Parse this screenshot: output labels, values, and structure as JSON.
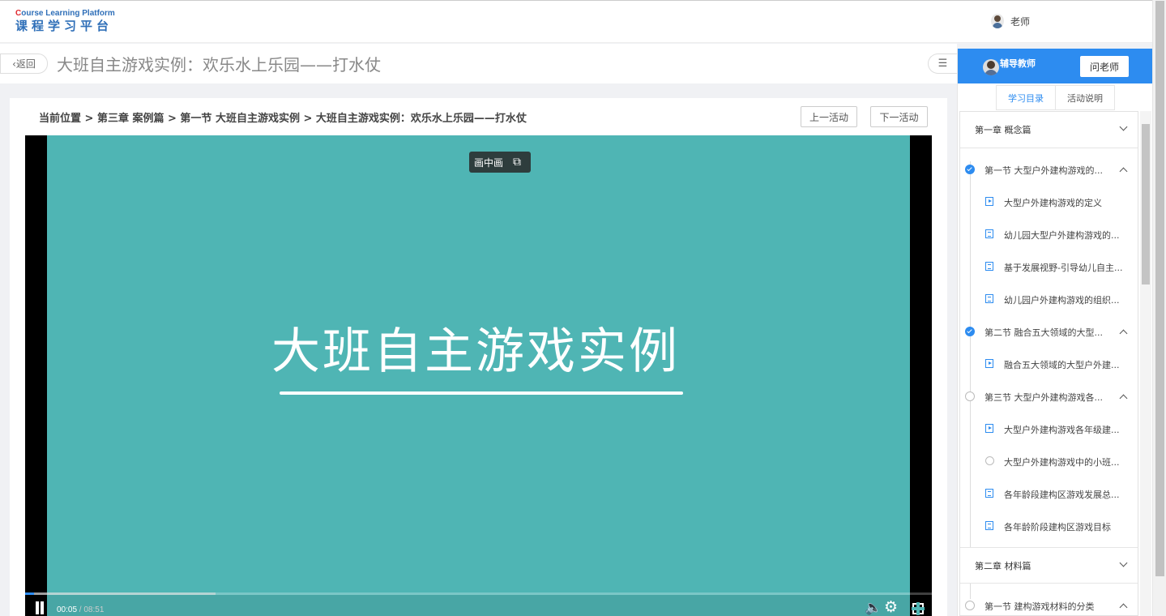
{
  "header": {
    "logo_en_first": "C",
    "logo_en_rest": "ourse Learning Platform",
    "logo_cn": "课程学习平台",
    "user_name": "老师"
  },
  "titlebar": {
    "back_label": "返回",
    "title": "大班自主游戏实例：欢乐水上乐园——打水仗"
  },
  "content": {
    "breadcrumb": "当前位置 > 第三章 案例篇 > 第一节 大班自主游戏实例 > 大班自主游戏实例：欢乐水上乐园——打水仗",
    "prev_label": "上一活动",
    "next_label": "下一活动"
  },
  "player": {
    "pip_label": "画中画",
    "video_title": "大班自主游戏实例",
    "current_time": "00:05",
    "separator": " / ",
    "duration": "08:51",
    "progress_fraction": 0.0098,
    "buffered_fraction": 0.21,
    "stage_color": "#4fb5b4"
  },
  "sidebar": {
    "tutor_label": "辅导教师",
    "ask_label": "问老师",
    "tabs": [
      {
        "label": "学习目录",
        "active": true
      },
      {
        "label": "活动说明",
        "active": false
      }
    ],
    "chapter1": {
      "title": "第一章 概念篇"
    },
    "sections": [
      {
        "title": "第一节 大型户外建构游戏的...",
        "status": "done"
      },
      {
        "title": "第二节 融合五大领域的大型...",
        "status": "done"
      },
      {
        "title": "第三节 大型户外建构游戏各...",
        "status": "todo"
      }
    ],
    "lessons": [
      {
        "title": "大型户外建构游戏的定义",
        "type": "video"
      },
      {
        "title": "幼儿园大型户外建构游戏的...",
        "type": "doc"
      },
      {
        "title": "基于发展视野-引导幼儿自主...",
        "type": "doc"
      },
      {
        "title": "幼儿园户外建构游戏的组织...",
        "type": "doc"
      },
      {
        "title": "融合五大领域的大型户外建...",
        "type": "video"
      },
      {
        "title": "大型户外建构游戏各年级建...",
        "type": "video"
      },
      {
        "title": "大型户外建构游戏中的小班...",
        "type": "pending"
      },
      {
        "title": "各年龄段建构区游戏发展总...",
        "type": "doc"
      },
      {
        "title": "各年龄阶段建构区游戏目标",
        "type": "doc"
      }
    ],
    "chapter2": {
      "title": "第二章 材料篇"
    },
    "chapter2_sections": [
      {
        "title": "第一节 建构游戏材料的分类",
        "status": "todo"
      }
    ],
    "accent_color": "#2d8cf0"
  }
}
